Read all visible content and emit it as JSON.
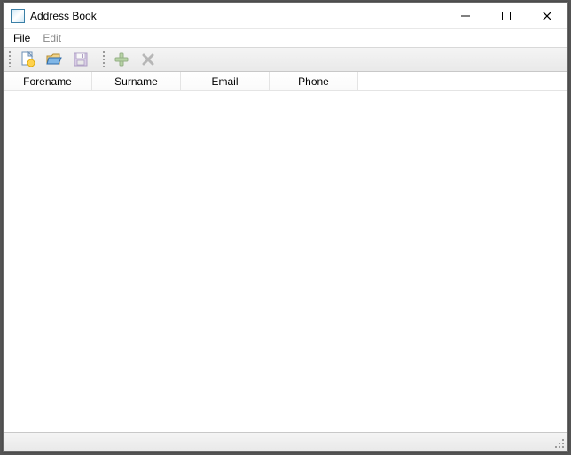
{
  "window": {
    "title": "Address Book"
  },
  "menu": {
    "file": "File",
    "edit": "Edit",
    "edit_enabled": false
  },
  "toolbar": {
    "new_doc": "new-document-icon",
    "open": "folder-open-icon",
    "save": "save-icon",
    "add": "add-icon",
    "delete": "delete-icon"
  },
  "table": {
    "columns": [
      "Forename",
      "Surname",
      "Email",
      "Phone"
    ],
    "rows": []
  },
  "statusbar": {
    "text": ""
  }
}
